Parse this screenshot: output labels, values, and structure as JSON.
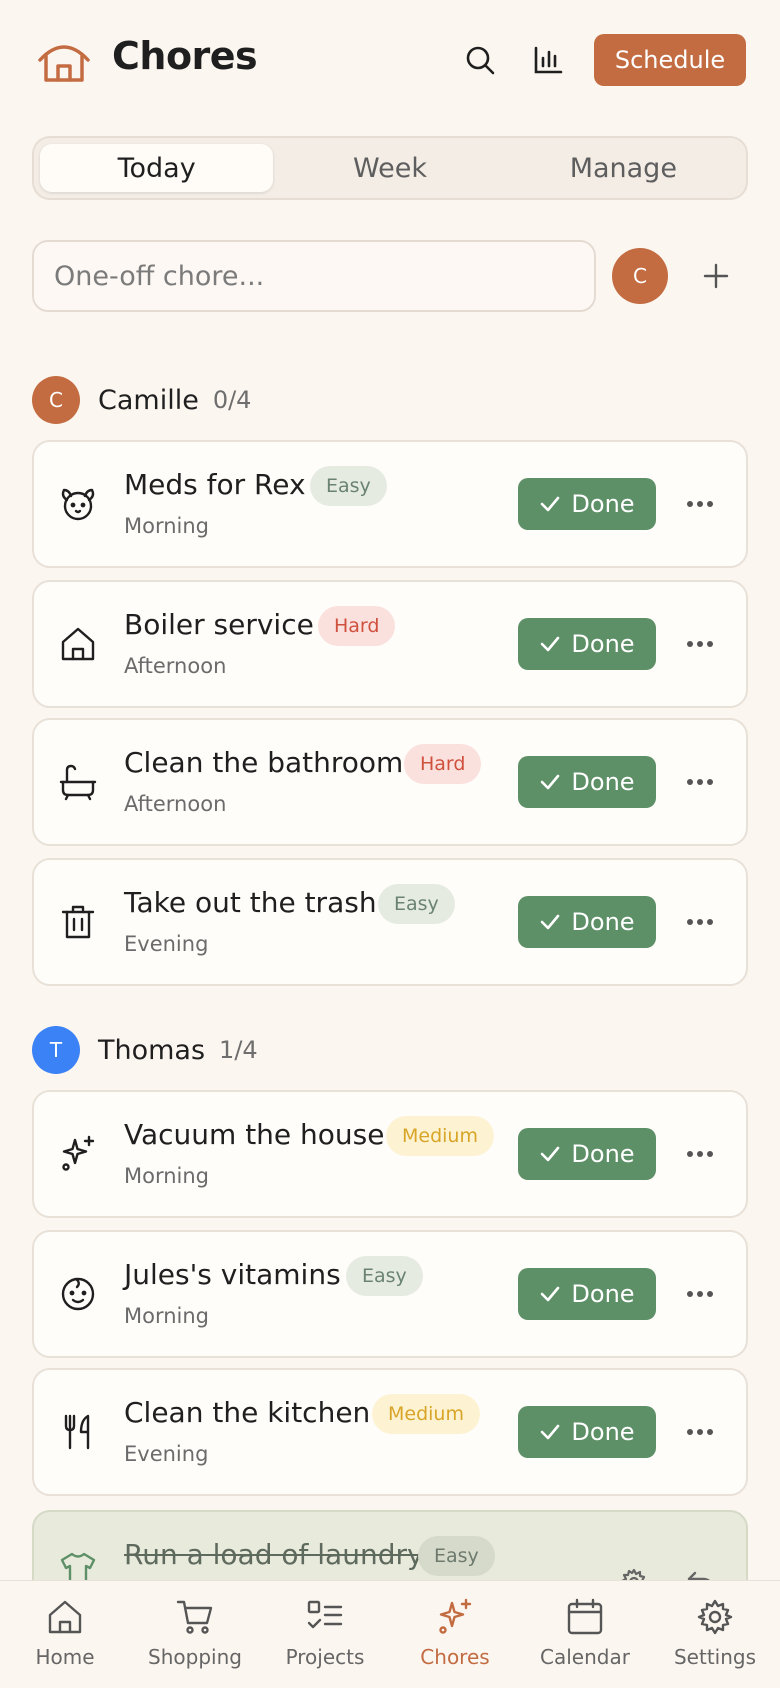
{
  "colors": {
    "accent": "#c36c42",
    "done_green": "#5e9068",
    "thomas_blue": "#3b82f6",
    "background": "#fcf6f0"
  },
  "header": {
    "title": "Chores",
    "schedule_label": "Schedule",
    "icons": [
      "home-icon",
      "search-icon",
      "bar-chart-icon"
    ]
  },
  "tabs": [
    {
      "label": "Today",
      "active": true
    },
    {
      "label": "Week",
      "active": false
    },
    {
      "label": "Manage",
      "active": false
    }
  ],
  "oneoff": {
    "placeholder": "One-off chore...",
    "assignee_initial": "C",
    "add_icon": "plus-icon"
  },
  "people": [
    {
      "initial": "C",
      "name": "Camille",
      "count": "0/4",
      "chores": [
        {
          "title": "Meds for Rex",
          "difficulty": "Easy",
          "time": "Morning",
          "icon": "dog-icon",
          "done_label": "Done"
        },
        {
          "title": "Boiler service",
          "difficulty": "Hard",
          "time": "Afternoon",
          "icon": "house-icon",
          "done_label": "Done"
        },
        {
          "title": "Clean the bathroom",
          "difficulty": "Hard",
          "time": "Afternoon",
          "icon": "bathtub-icon",
          "done_label": "Done"
        },
        {
          "title": "Take out the trash",
          "difficulty": "Easy",
          "time": "Evening",
          "icon": "trash-icon",
          "done_label": "Done"
        }
      ]
    },
    {
      "initial": "T",
      "name": "Thomas",
      "count": "1/4",
      "chores": [
        {
          "title": "Vacuum the house",
          "difficulty": "Medium",
          "time": "Morning",
          "icon": "sparkles-icon",
          "done_label": "Done"
        },
        {
          "title": "Jules's vitamins",
          "difficulty": "Easy",
          "time": "Morning",
          "icon": "baby-icon",
          "done_label": "Done"
        },
        {
          "title": "Clean the kitchen",
          "difficulty": "Medium",
          "time": "Evening",
          "icon": "utensils-icon",
          "done_label": "Done"
        },
        {
          "title": "Run a load of laundry",
          "difficulty": "Easy",
          "completed": true,
          "icon": "shirt-icon"
        }
      ]
    }
  ],
  "bottom_nav": [
    {
      "label": "Home",
      "icon": "home-icon"
    },
    {
      "label": "Shopping",
      "icon": "cart-icon"
    },
    {
      "label": "Projects",
      "icon": "checklist-icon"
    },
    {
      "label": "Chores",
      "icon": "sparkles-icon",
      "active": true
    },
    {
      "label": "Calendar",
      "icon": "calendar-icon"
    },
    {
      "label": "Settings",
      "icon": "settings-icon"
    }
  ]
}
